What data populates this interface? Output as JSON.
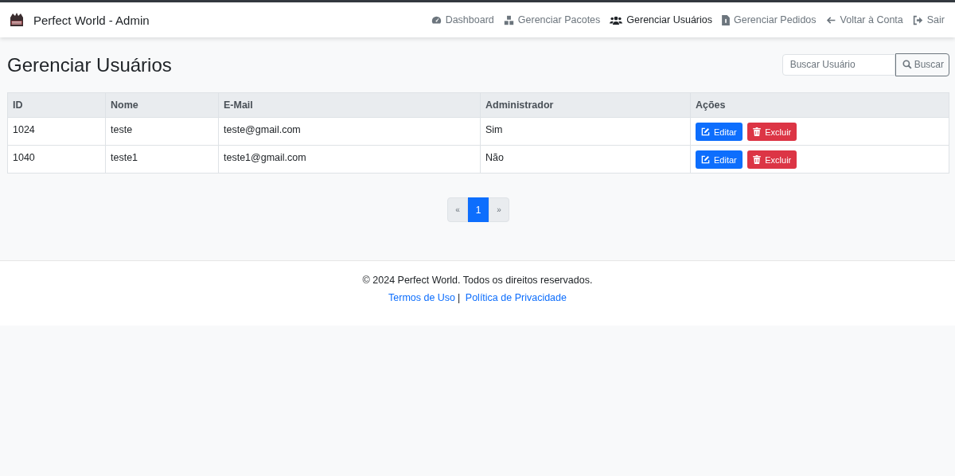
{
  "navbar": {
    "brand": "Perfect World - Admin",
    "items": [
      {
        "label": "Dashboard",
        "selected": false
      },
      {
        "label": "Gerenciar Pacotes",
        "selected": false
      },
      {
        "label": "Gerenciar Usuários",
        "selected": true
      },
      {
        "label": "Gerenciar Pedidos",
        "selected": false
      },
      {
        "label": "Voltar à Conta",
        "selected": false
      },
      {
        "label": "Sair",
        "selected": false
      }
    ]
  },
  "page_title": "Gerenciar Usuários",
  "search": {
    "placeholder": "Buscar Usuário",
    "button": "Buscar"
  },
  "table": {
    "columns": [
      "ID",
      "Nome",
      "E-Mail",
      "Administrador",
      "Ações"
    ],
    "rows": [
      {
        "id": "1024",
        "name": "teste",
        "email": "teste@gmail.com",
        "admin": "Sim",
        "edit": "Editar",
        "delete": "Excluir"
      },
      {
        "id": "1040",
        "name": "teste1",
        "email": "teste1@gmail.com",
        "admin": "Não",
        "edit": "Editar",
        "delete": "Excluir"
      }
    ]
  },
  "pagination": [
    {
      "label": "«",
      "selected": false
    },
    {
      "label": "1",
      "selected": true
    },
    {
      "label": "»",
      "selected": false
    }
  ],
  "footer": {
    "copyright": "© 2024 Perfect World. Todos os direitos reservados.",
    "links": [
      "Termos de Uso",
      "Política de Privacidade"
    ],
    "separator": "|"
  }
}
